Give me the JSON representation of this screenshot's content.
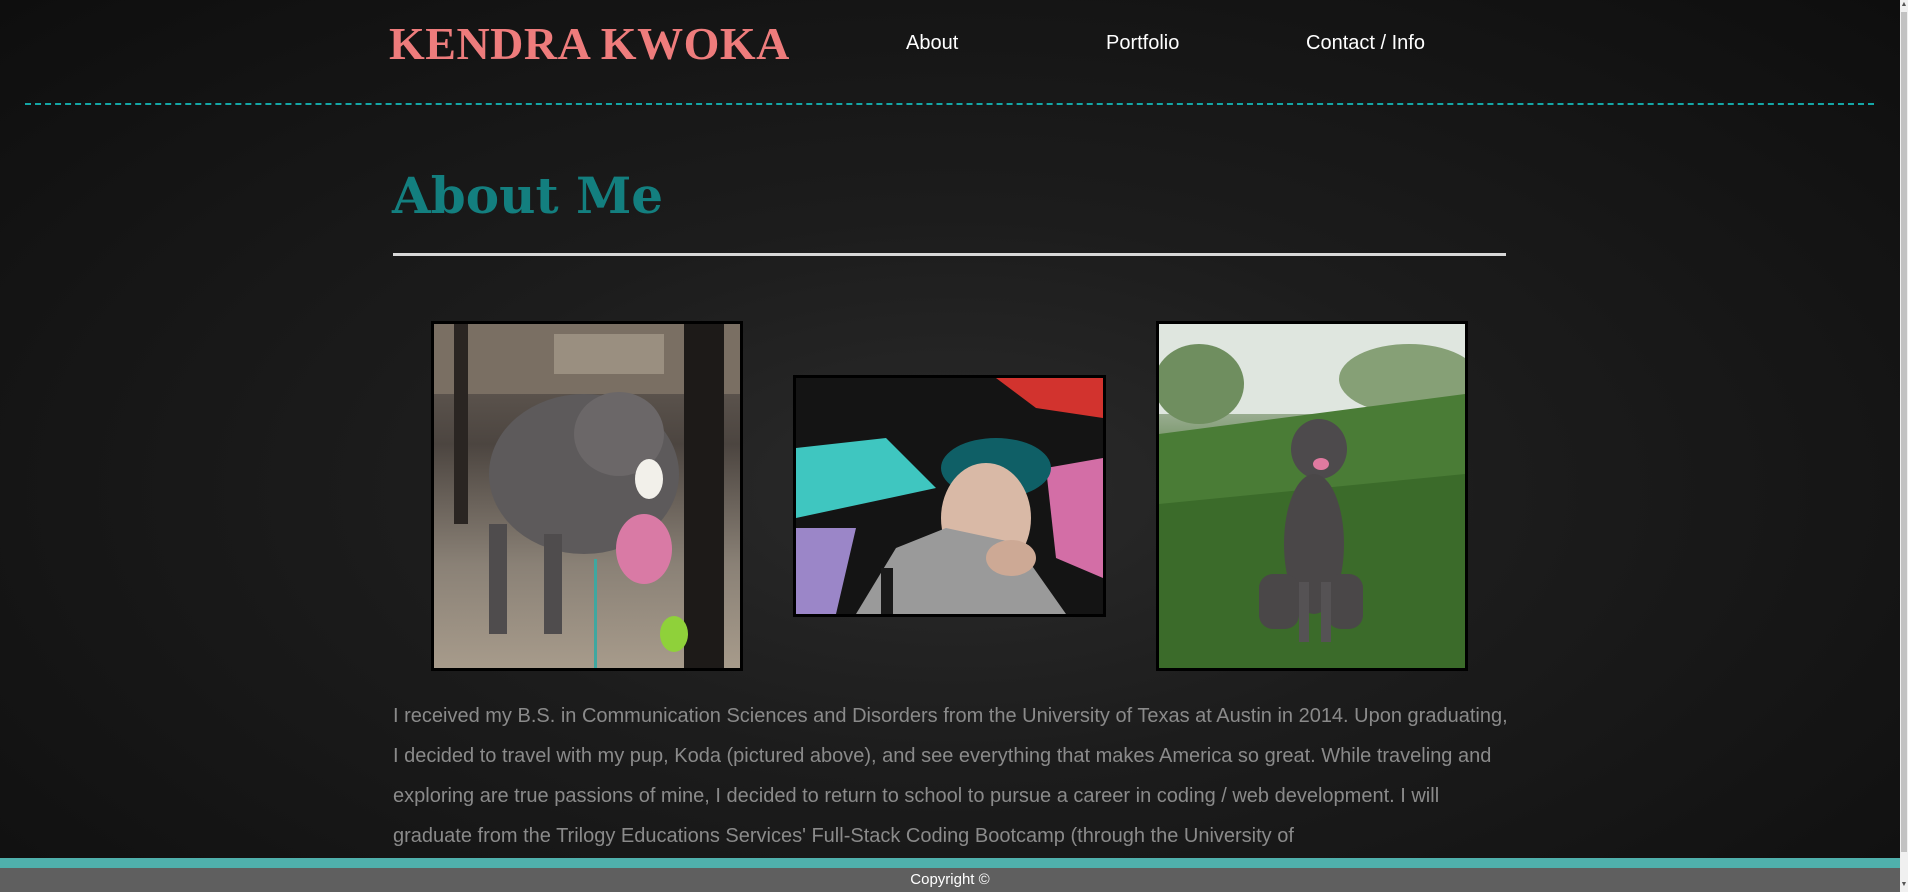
{
  "header": {
    "brand": "KENDRA KWOKA",
    "nav": [
      "About",
      "Portfolio",
      "Contact / Info"
    ]
  },
  "main": {
    "title": "About Me",
    "photos": [
      {
        "subject": "Koda the dog outdoors at a patio"
      },
      {
        "subject": "Portrait of Kendra against graffiti wall"
      },
      {
        "subject": "Koda the dog sitting on grass"
      }
    ],
    "bio": "I received my B.S. in Communication Sciences and Disorders from the University of Texas at Austin in 2014. Upon graduating, I decided to travel with my pup, Koda (pictured above), and see everything that makes America so great. While traveling and exploring are true passions of mine, I decided to return to school to pursue a career in coding / web development. I will graduate from the Trilogy Educations Services' Full-Stack Coding Bootcamp (through the University of"
  },
  "footer": {
    "copyright": "Copyright ©"
  },
  "colors": {
    "brand": "#ee7c7c",
    "title": "#137f7f",
    "header_rule": "#14a6a6",
    "footer_bar": "#4fb0ac",
    "footer_bg": "#5f5f5f",
    "body_text": "#8a8a8a"
  }
}
